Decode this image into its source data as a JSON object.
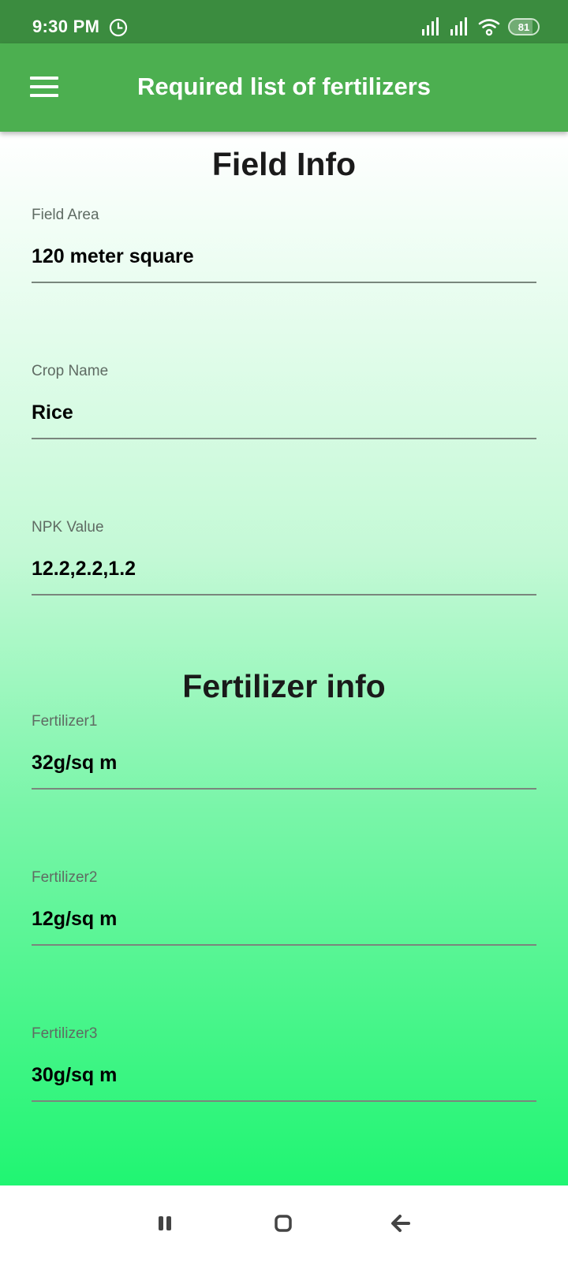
{
  "status_bar": {
    "time": "9:30 PM",
    "alarm_icon": "alarm-clock-icon",
    "battery_level": "81"
  },
  "app_bar": {
    "title": "Required list of fertilizers",
    "menu_icon": "hamburger-menu-icon"
  },
  "field_info": {
    "heading": "Field Info",
    "fields": [
      {
        "label": "Field Area",
        "value": "120 meter square"
      },
      {
        "label": "Crop Name",
        "value": "Rice"
      },
      {
        "label": "NPK Value",
        "value": "12.2,2.2,1.2"
      }
    ]
  },
  "fertilizer_info": {
    "heading": "Fertilizer info",
    "fields": [
      {
        "label": "Fertilizer1",
        "value": "32g/sq m"
      },
      {
        "label": "Fertilizer2",
        "value": "12g/sq m"
      },
      {
        "label": "Fertilizer3",
        "value": "30g/sq m"
      }
    ]
  },
  "nav_bar": {
    "recents_icon": "recents-icon",
    "home_icon": "home-icon",
    "back_icon": "back-arrow-icon"
  },
  "colors": {
    "status_bar": "#3b8c3f",
    "app_bar": "#4caf50",
    "gradient_top": "#ffffff",
    "gradient_bottom": "#20f572"
  }
}
